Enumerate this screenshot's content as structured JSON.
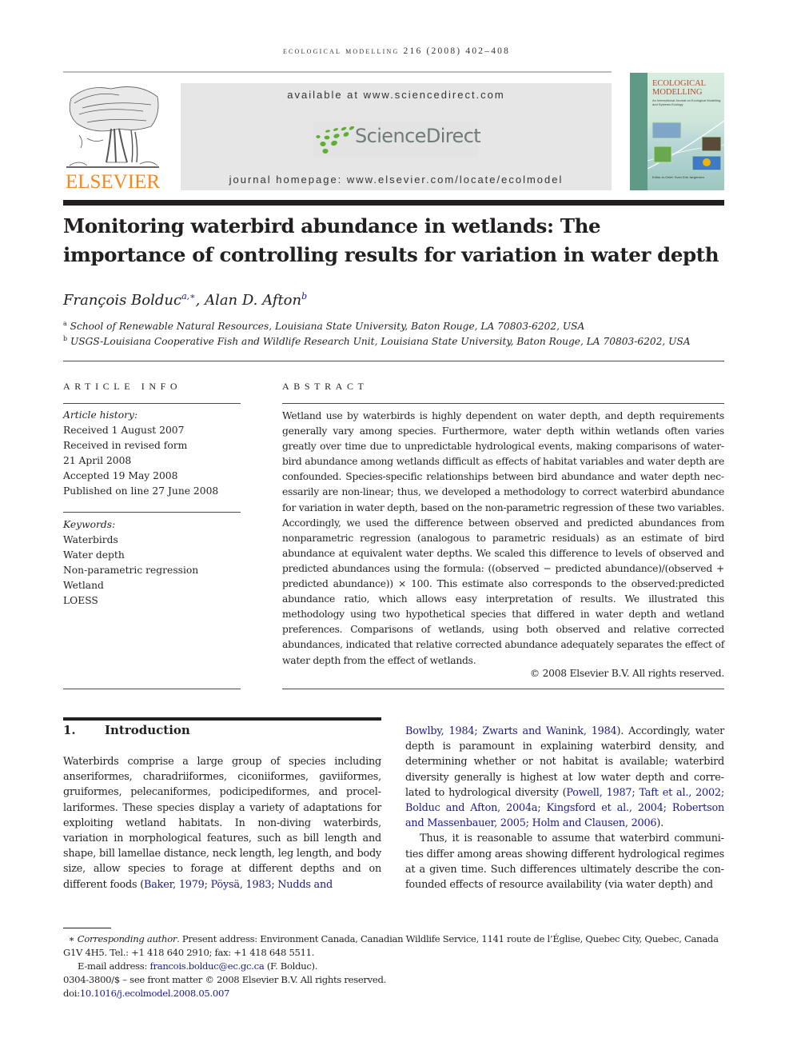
{
  "running_head": "ECOLOGICAL MODELLING 216 (2008) 402–408",
  "publisher": {
    "logo_icon": "elsevier-tree-icon",
    "name": "ELSEVIER"
  },
  "sciencedirect": {
    "available_at": "available at www.sciencedirect.com",
    "logo_icon": "sciencedirect-dots-icon",
    "logo_text": "ScienceDirect",
    "homepage": "journal homepage: www.elsevier.com/locate/ecolmodel",
    "colors": {
      "dots": "#5cb031",
      "wordmark": "#6f7b78",
      "box": "#e6e6e6"
    }
  },
  "journal_cover": {
    "title_line1": "ECOLOGICAL",
    "title_line2": "MODELLING",
    "subtitle": "An International Journal on Ecological Modelling and Systems Ecology",
    "editors": "Editor-in-Chief: Sven Erik Jørgensen",
    "colors": {
      "title": "#b54a2e",
      "spine": "#5f9a86"
    }
  },
  "article": {
    "title": "Monitoring waterbird abundance in wetlands: The importance of controlling results for variation in water depth",
    "authors": [
      {
        "name": "François Bolduc",
        "sup": "a,∗"
      },
      {
        "name": "Alan D. Afton",
        "sup": "b"
      }
    ],
    "affiliations": [
      {
        "key": "a",
        "text": "School of Renewable Natural Resources, Louisiana State University, Baton Rouge, LA 70803-6202, USA"
      },
      {
        "key": "b",
        "text": "USGS-Louisiana Cooperative Fish and Wildlife Research Unit, Louisiana State University, Baton Rouge, LA 70803-6202, USA"
      }
    ]
  },
  "article_info": {
    "heading": "ARTICLE INFO",
    "history_label": "Article history:",
    "history": [
      "Received 1 August 2007",
      "Received in revised form",
      "21 April 2008",
      "Accepted 19 May 2008",
      "Published on line 27 June 2008"
    ],
    "keywords_label": "Keywords:",
    "keywords": [
      "Waterbirds",
      "Water depth",
      "Non-parametric regression",
      "Wetland",
      "LOESS"
    ]
  },
  "abstract": {
    "heading": "ABSTRACT",
    "text": "Wetland use by waterbirds is highly dependent on water depth, and depth requirements generally vary among species. Furthermore, water depth within wetlands often varies greatly over time due to unpredictable hydrological events, making comparisons of water­bird abundance among wetlands difficult as effects of habitat variables and water depth are confounded. Species-specific relationships between bird abundance and water depth nec­essarily are non-linear; thus, we developed a methodology to correct waterbird abundance for variation in water depth, based on the non-parametric regression of these two variables. Accordingly, we used the difference between observed and predicted abundances from non­parametric regression (analogous to parametric residuals) as an estimate of bird abundance at equivalent water depths. We scaled this difference to levels of observed and predicted abundances using the formula: ((observed − predicted abundance)/(observed + predicted abundance)) × 100. This estimate also corresponds to the observed:predicted abundance ratio, which allows easy interpretation of results. We illustrated this methodology using two hypothetical species that differed in water depth and wetland preferences. Compar­isons of wetlands, using both observed and relative corrected abundances, indicated that relative corrected abundance adequately separates the effect of water depth from the effect of wetlands.",
    "copyright": "© 2008 Elsevier B.V. All rights reserved."
  },
  "introduction": {
    "number": "1.",
    "heading": "Introduction",
    "left_text": "Waterbirds comprise a large group of species including anseriformes, charadriiformes, ciconiiformes, gaviiformes, gruiformes, pelecaniformes, podicipediformes, and procel­lariformes. These species display a variety of adaptations for exploiting wetland habitats. In non-diving waterbirds, variation in morphological features, such as bill length and shape, bill lamellae distance, neck length, leg length, and body size, allow species to forage at different depths and on different foods (",
    "left_citation": "Baker, 1979; Pöysä, 1983; Nudds and",
    "right_citation_1": "Bowlby, 1984; Zwarts and Wanink, 1984",
    "right_text_1": "). Accordingly, water depth is paramount in explaining waterbird density, and determining whether or not habitat is available; waterbird diversity generally is highest at low water depth and corre­lated to hydrological diversity (",
    "right_citation_2": "Powell, 1987; Taft et al., 2002; Bolduc and Afton, 2004a; Kingsford et al., 2004; Robertson and Massenbauer, 2005; Holm and Clausen, 2006",
    "right_text_2": ").",
    "right_paragraph_2": "Thus, it is reasonable to assume that waterbird communi­ties differ among areas showing different hydrological regimes at a given time. Such differences ultimately describe the con­founded effects of resource availability (via water depth) and"
  },
  "footnotes": {
    "star": "∗",
    "corresponding_label": "Corresponding author",
    "corresponding_text": ". Present address: Environment Canada, Canadian Wildlife Service, 1141 route de l’Église, Quebec City, Quebec, Canada G1V 4H5. Tel.: +1 418 640 2910; fax: +1 418 648 5511.",
    "email_label": "E-mail address:",
    "email": "francois.bolduc@ec.gc.ca",
    "email_suffix": "(F. Bolduc).",
    "front_matter": "0304-3800/$ – see front matter © 2008 Elsevier B.V. All rights reserved.",
    "doi_label": "doi:",
    "doi": "10.1016/j.ecolmodel.2008.05.007"
  }
}
